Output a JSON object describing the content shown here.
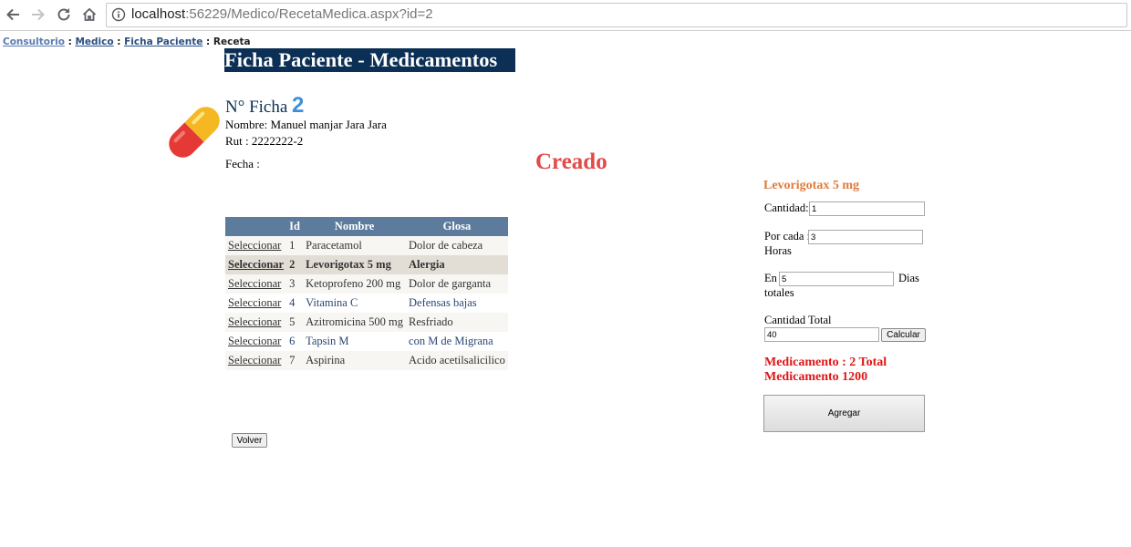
{
  "browser": {
    "url_host": "localhost",
    "url_rest": ":56229/Medico/RecetaMedica.aspx?id=2"
  },
  "breadcrumb": {
    "items": [
      "Consultorio",
      "Medico",
      "Ficha Paciente",
      "Receta"
    ],
    "separator": ":"
  },
  "page": {
    "title": "Ficha Paciente - Medicamentos",
    "ficha_label": "N° Ficha",
    "ficha_number": "2",
    "nombre_label": "Nombre:",
    "nombre_value": "Manuel manjar Jara Jara",
    "rut_label": "Rut :",
    "rut_value": "2222222-2",
    "fecha_label": "Fecha :",
    "status": "Creado"
  },
  "grid": {
    "headers": [
      "",
      "Id",
      "Nombre",
      "Glosa"
    ],
    "select_label": "Seleccionar",
    "selected_index": 1,
    "rows": [
      {
        "id": "1",
        "nombre": "Paracetamol",
        "glosa": "Dolor de cabeza"
      },
      {
        "id": "2",
        "nombre": "Levorigotax 5 mg",
        "glosa": "Alergia"
      },
      {
        "id": "3",
        "nombre": "Ketoprofeno 200 mg",
        "glosa": "Dolor de garganta"
      },
      {
        "id": "4",
        "nombre": "Vitamina C",
        "glosa": "Defensas bajas"
      },
      {
        "id": "5",
        "nombre": "Azitromicina 500 mg",
        "glosa": "Resfriado"
      },
      {
        "id": "6",
        "nombre": "Tapsin M",
        "glosa": "con M de Migrana"
      },
      {
        "id": "7",
        "nombre": "Aspirina",
        "glosa": "Acido acetilsalicilico"
      }
    ]
  },
  "buttons": {
    "volver": "Volver",
    "calcular": "Calcular",
    "agregar": "Agregar"
  },
  "panel": {
    "med_name": "Levorigotax 5 mg",
    "cantidad_label": "Cantidad:",
    "cantidad_value": "1",
    "por_cada_label": "Por cada :",
    "por_cada_value": "3",
    "horas_label": "Horas",
    "en_label": "En",
    "en_value": "5",
    "dias_label": "Dias",
    "totales_label": "totales",
    "cantidad_total_label": "Cantidad Total",
    "cantidad_total_value": "40",
    "result_text": "Medicamento : 2 Total Medicamento 1200"
  },
  "colors": {
    "title_bg": "#0b2f55",
    "grid_header_bg": "#5d7b9d",
    "status_red": "#e24a4a",
    "med_orange": "#e07a3a",
    "result_red": "#e01616",
    "ficha_blue": "#3d8fd8"
  },
  "icons": [
    "back-arrow-icon",
    "forward-arrow-icon",
    "reload-icon",
    "home-icon",
    "info-icon",
    "pill-icon"
  ]
}
